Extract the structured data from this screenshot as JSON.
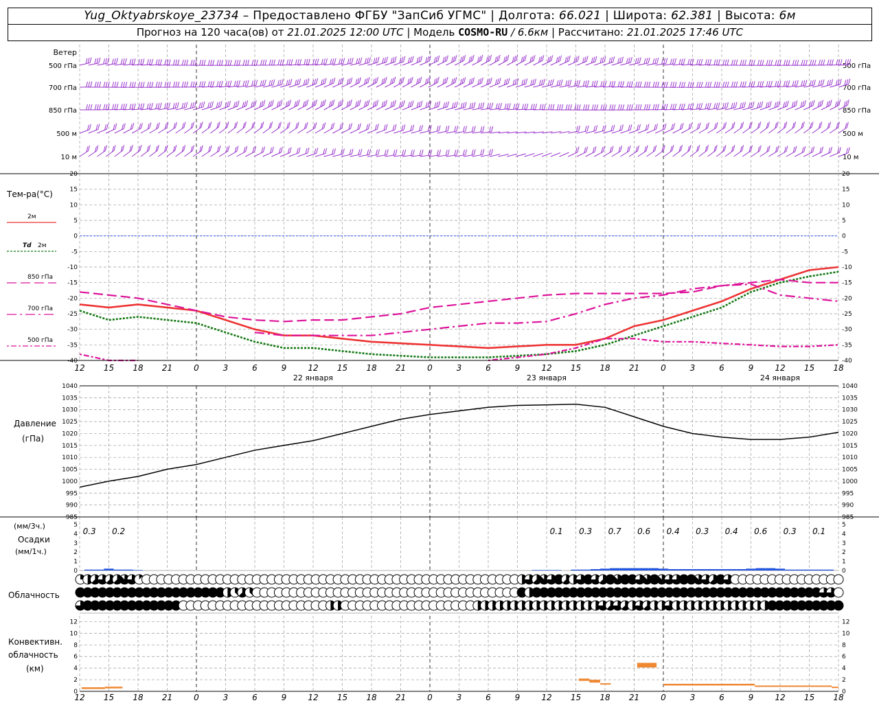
{
  "header": {
    "station": "Yug_Oktyabrskoye_23734",
    "provider": "– Предоставлено ФГБУ \"ЗапСиб УГМС\"",
    "lon_label": "| Долгота:",
    "lon": "66.021",
    "lat_label": "| Широта:",
    "lat": "62.381",
    "alt_label": "| Высота:",
    "alt": "6м",
    "forecast_text": "Прогноз на 120 часа(ов) от",
    "run": "21.01.2025 12:00 UTC",
    "model_label": "| Модель",
    "model": "COSMO-RU",
    "resolution": "/ 6.6км",
    "calc_label": "| Рассчитано:",
    "calc_time": "21.01.2025 17:46 UTC"
  },
  "time_axis": {
    "hour_labels": [
      "12",
      "15",
      "18",
      "21",
      "0",
      "3",
      "6",
      "9",
      "12",
      "15",
      "18",
      "21",
      "0",
      "3",
      "6",
      "9",
      "12",
      "15",
      "18",
      "21",
      "0",
      "3",
      "6",
      "9",
      "12",
      "15",
      "18"
    ],
    "day_labels": [
      {
        "hour_index": 8,
        "text": "22 января"
      },
      {
        "hour_index": 16,
        "text": "23 января"
      },
      {
        "hour_index": 24,
        "text": "24 января"
      }
    ]
  },
  "wind_panel": {
    "title": "Ветер",
    "levels": [
      "500 гПа",
      "700 гПа",
      "850 гПа",
      "500 м",
      "10  м"
    ],
    "color": "#9933cc"
  },
  "chart_data": [
    {
      "type": "line",
      "name": "temperature",
      "title": "Тем-ра(°С)",
      "ylim": [
        -40,
        20
      ],
      "yticks": [
        20,
        15,
        10,
        5,
        0,
        -5,
        -10,
        -15,
        -20,
        -25,
        -30,
        -35,
        -40
      ],
      "x_hours": [
        0,
        3,
        6,
        9,
        12,
        15,
        18,
        21,
        24,
        27,
        30,
        33,
        36,
        39,
        42,
        45,
        48,
        51,
        54,
        57,
        60,
        63,
        66,
        69,
        72,
        75,
        78
      ],
      "series": [
        {
          "name": "2м",
          "color": "#ee3333",
          "style": "solid",
          "values": [
            -22,
            -23,
            -22,
            -23,
            -24,
            -27,
            -30,
            -32,
            -32,
            -33,
            -34,
            -34.5,
            -35,
            -35.5,
            -36,
            -35.5,
            -35,
            -35,
            -33,
            -29,
            -27,
            -24,
            -21,
            -17,
            -14,
            -11,
            -10
          ]
        },
        {
          "name": "Td 2м",
          "color": "#117711",
          "style": "dotted",
          "values": [
            -24,
            -27,
            -26,
            -27,
            -28,
            -31,
            -34,
            -36,
            -36,
            -37,
            -38,
            -38.5,
            -39,
            -39,
            -39,
            -38.5,
            -38,
            -37,
            -35,
            -32,
            -29,
            -26,
            -23,
            -18,
            -15,
            -13,
            -11.5
          ]
        },
        {
          "name": "850 гПа",
          "color": "#dd1199",
          "style": "dashed",
          "values": [
            -18,
            -19,
            -20,
            -22,
            -24,
            -26,
            -27,
            -27.5,
            -27,
            -27,
            -26,
            -25,
            -23,
            -22,
            -21,
            -20,
            -19,
            -18.5,
            -18.5,
            -18.5,
            -18.5,
            -18,
            -16,
            -15,
            -14,
            -15,
            -15
          ]
        },
        {
          "name": "700 гПа",
          "color": "#dd1199",
          "style": "dashdot",
          "values": [
            null,
            null,
            null,
            null,
            null,
            null,
            -31,
            -32,
            -32,
            -32,
            -32,
            -31,
            -30,
            -29,
            -28,
            -28,
            -27.5,
            -25,
            -22,
            -20,
            -19,
            -17,
            -16,
            -15.5,
            -19,
            -20,
            -21
          ]
        },
        {
          "name": "500 гПа",
          "color": "#dd1199",
          "style": "dotdash",
          "values": [
            -38,
            -40,
            -40,
            null,
            null,
            null,
            null,
            null,
            null,
            null,
            null,
            null,
            null,
            null,
            -40,
            -39,
            -38,
            -36,
            -33,
            -33,
            -34,
            -34,
            -34.5,
            -35,
            -35.5,
            -35.5,
            -35
          ]
        }
      ]
    },
    {
      "type": "line",
      "name": "pressure",
      "title": "Давление",
      "unit": "(гПа)",
      "ylim": [
        985,
        1040
      ],
      "yticks": [
        1040,
        1035,
        1030,
        1025,
        1020,
        1015,
        1010,
        1005,
        1000,
        995,
        990,
        985
      ],
      "x_hours": [
        0,
        3,
        6,
        9,
        12,
        15,
        18,
        21,
        24,
        27,
        30,
        33,
        36,
        39,
        42,
        45,
        48,
        51,
        54,
        57,
        60,
        63,
        66,
        69,
        72,
        75,
        78
      ],
      "values": [
        997.5,
        1000,
        1002,
        1005,
        1007,
        1010,
        1013,
        1015,
        1017,
        1020,
        1023,
        1026,
        1028,
        1029.5,
        1031,
        1031.8,
        1032,
        1032.3,
        1031,
        1027,
        1023,
        1020,
        1018.5,
        1017.5,
        1017.5,
        1018.5,
        1020.5
      ],
      "color": "#000000"
    },
    {
      "type": "bar",
      "name": "precipitation",
      "title": "Осадки",
      "unit_3h": "(мм/3ч.)",
      "unit_1h": "(мм/1ч.)",
      "ylim": [
        0,
        5
      ],
      "yticks": [
        5,
        4,
        3,
        2,
        1,
        0
      ],
      "totals": [
        {
          "hour": 1,
          "text": "0.3"
        },
        {
          "hour": 4,
          "text": "0.2"
        },
        {
          "hour": 49,
          "text": "0.1"
        },
        {
          "hour": 52,
          "text": "0.3"
        },
        {
          "hour": 55,
          "text": "0.7"
        },
        {
          "hour": 58,
          "text": "0.6"
        },
        {
          "hour": 61,
          "text": "0.4"
        },
        {
          "hour": 64,
          "text": "0.3"
        },
        {
          "hour": 67,
          "text": "0.4"
        },
        {
          "hour": 70,
          "text": "0.6"
        },
        {
          "hour": 73,
          "text": "0.3"
        },
        {
          "hour": 76,
          "text": "0.1"
        }
      ],
      "hourly_bars": [
        [
          1,
          0.1
        ],
        [
          2,
          0.1
        ],
        [
          3,
          0.2
        ],
        [
          4,
          0.1
        ],
        [
          5,
          0.1
        ],
        [
          6,
          0.05
        ],
        [
          47,
          0.05
        ],
        [
          48,
          0.05
        ],
        [
          49,
          0.05
        ],
        [
          51,
          0.1
        ],
        [
          52,
          0.1
        ],
        [
          53,
          0.15
        ],
        [
          54,
          0.2
        ],
        [
          55,
          0.25
        ],
        [
          56,
          0.25
        ],
        [
          57,
          0.25
        ],
        [
          58,
          0.25
        ],
        [
          59,
          0.25
        ],
        [
          60,
          0.2
        ],
        [
          61,
          0.15
        ],
        [
          62,
          0.15
        ],
        [
          63,
          0.15
        ],
        [
          64,
          0.15
        ],
        [
          65,
          0.15
        ],
        [
          66,
          0.15
        ],
        [
          67,
          0.15
        ],
        [
          68,
          0.15
        ],
        [
          69,
          0.2
        ],
        [
          70,
          0.25
        ],
        [
          71,
          0.25
        ],
        [
          72,
          0.2
        ],
        [
          73,
          0.1
        ],
        [
          74,
          0.1
        ],
        [
          75,
          0.1
        ],
        [
          76,
          0.1
        ],
        [
          77,
          0.1
        ]
      ],
      "color": "#2255dd"
    },
    {
      "type": "table",
      "name": "cloudiness",
      "title": "Облачность",
      "rows": [
        {
          "level": "upper",
          "values": [
            2,
            4,
            5,
            6,
            5,
            5,
            7,
            6,
            1,
            0,
            0,
            0,
            0,
            0,
            0,
            0,
            0,
            0,
            0,
            0,
            0,
            0,
            0,
            0,
            0,
            0,
            0,
            0,
            0,
            0,
            0,
            0,
            0,
            0,
            0,
            0,
            0,
            0,
            0,
            0,
            0,
            0,
            0,
            0,
            0,
            0,
            0,
            0,
            0,
            0,
            0,
            0,
            0,
            0,
            0,
            0,
            0,
            0,
            0,
            0,
            4,
            6,
            5,
            7,
            6,
            8,
            5,
            4,
            6,
            8,
            6,
            5,
            8,
            7,
            8,
            8,
            6,
            7,
            8,
            7,
            6,
            6,
            8,
            8,
            7,
            6,
            5,
            8,
            6,
            0,
            0,
            0,
            0,
            0,
            0,
            0,
            0,
            0,
            0,
            0,
            0,
            0,
            0,
            0
          ]
        },
        {
          "level": "middle",
          "values": [
            8,
            8,
            8,
            8,
            8,
            8,
            8,
            8,
            8,
            8,
            8,
            8,
            8,
            8,
            8,
            8,
            8,
            8,
            8,
            8,
            4,
            3,
            5,
            3,
            0,
            0,
            0,
            0,
            0,
            0,
            0,
            0,
            0,
            0,
            0,
            0,
            0,
            0,
            0,
            0,
            0,
            0,
            0,
            0,
            0,
            0,
            0,
            0,
            0,
            0,
            0,
            0,
            0,
            0,
            0,
            0,
            0,
            0,
            0,
            0,
            8,
            4,
            8,
            8,
            8,
            8,
            8,
            8,
            8,
            8,
            8,
            8,
            8,
            8,
            8,
            8,
            8,
            8,
            8,
            8,
            8,
            8,
            8,
            8,
            8,
            8,
            8,
            8,
            8,
            8,
            8,
            8,
            8,
            8,
            8,
            8,
            8,
            8,
            8,
            8,
            8,
            6,
            6,
            0
          ]
        },
        {
          "level": "lower",
          "values": [
            6,
            8,
            8,
            8,
            8,
            8,
            8,
            8,
            8,
            8,
            8,
            8,
            8,
            8,
            0,
            0,
            0,
            0,
            0,
            0,
            0,
            0,
            0,
            0,
            0,
            0,
            0,
            0,
            0,
            0,
            0,
            0,
            0,
            0,
            4,
            4,
            0,
            0,
            0,
            0,
            0,
            0,
            0,
            0,
            0,
            0,
            0,
            0,
            0,
            0,
            0,
            0,
            0,
            0,
            4,
            4,
            4,
            4,
            4,
            4,
            4,
            4,
            4,
            4,
            4,
            4,
            4,
            4,
            4,
            4,
            4,
            6,
            5,
            6,
            5,
            4,
            6,
            5,
            4,
            4,
            6,
            4,
            4,
            4,
            4,
            4,
            4,
            4,
            4,
            4,
            4,
            4,
            4,
            4,
            8,
            8,
            8,
            8,
            8,
            8,
            8,
            8,
            8,
            8
          ]
        }
      ]
    },
    {
      "type": "bar",
      "name": "convective_cloudiness",
      "title": "Конвективн.",
      "title2": "облачность",
      "unit": "(км)",
      "ylim": [
        0,
        13
      ],
      "yticks": [
        12,
        10,
        8,
        6,
        4,
        2,
        0
      ],
      "segments": [
        {
          "from": 0.2,
          "to": 2.6,
          "base": 0.4,
          "top": 0.7
        },
        {
          "from": 2.6,
          "to": 4.4,
          "base": 0.5,
          "top": 0.8
        },
        {
          "from": 51.3,
          "to": 52.4,
          "base": 1.8,
          "top": 2.2
        },
        {
          "from": 52.4,
          "to": 53.5,
          "base": 1.5,
          "top": 2.0
        },
        {
          "from": 53.5,
          "to": 54.6,
          "base": 1.2,
          "top": 1.4
        },
        {
          "from": 57.3,
          "to": 59.3,
          "base": 4.1,
          "top": 4.9
        },
        {
          "from": 60.0,
          "to": 69.4,
          "base": 1.0,
          "top": 1.3
        },
        {
          "from": 69.4,
          "to": 77.3,
          "base": 0.8,
          "top": 1.0
        },
        {
          "from": 77.3,
          "to": 78.0,
          "base": 0.6,
          "top": 0.8
        }
      ],
      "color": "#ee8833"
    }
  ],
  "legend": {
    "temp": [
      {
        "text": "2м",
        "color": "#ee3333",
        "style": "solid"
      },
      {
        "text": "Td",
        "text2": "2м",
        "color": "#117711",
        "style": "dotted"
      },
      {
        "text": "850 гПа",
        "color": "#dd1199",
        "style": "dashed"
      },
      {
        "text": "700 гПа",
        "color": "#dd1199",
        "style": "dashdot"
      },
      {
        "text": "500 гПа",
        "color": "#dd1199",
        "style": "dotdash"
      }
    ]
  },
  "colors": {
    "zero_line": "#3355ee",
    "grid": "#999999"
  }
}
